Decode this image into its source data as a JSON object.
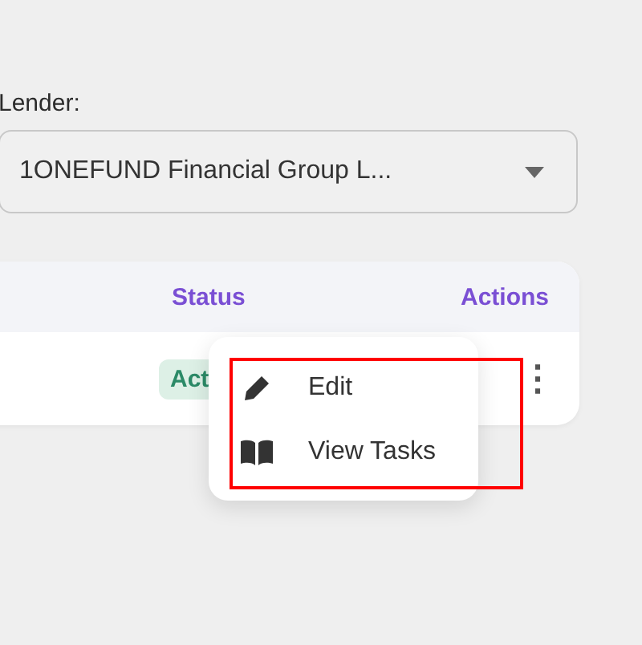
{
  "lender": {
    "label": "Lender:",
    "value": "1ONEFUND Financial Group L..."
  },
  "table": {
    "columns": [
      "Status",
      "Actions"
    ],
    "rows": [
      {
        "status": "Act",
        "actions": "⋮"
      }
    ]
  },
  "menu": {
    "items": [
      {
        "kind": "edit",
        "label": "Edit"
      },
      {
        "kind": "tasks",
        "label": "View Tasks"
      }
    ],
    "highlighted": true
  }
}
